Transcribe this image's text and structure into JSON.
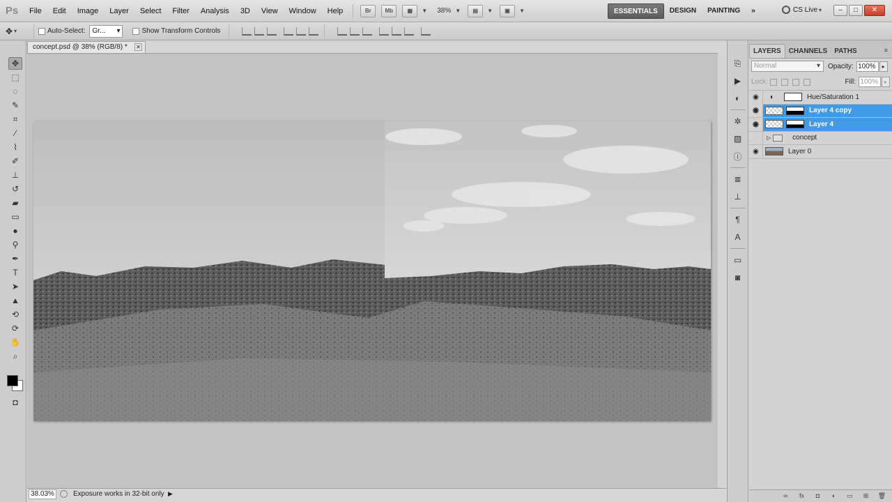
{
  "app": {
    "logo": "Ps"
  },
  "menu": [
    "File",
    "Edit",
    "Image",
    "Layer",
    "Select",
    "Filter",
    "Analysis",
    "3D",
    "View",
    "Window",
    "Help"
  ],
  "toolbar": {
    "bridge": "Br",
    "minibridge": "Mb",
    "zoom": "38%"
  },
  "workspaces": {
    "active": "ESSENTIALS",
    "design": "DESIGN",
    "painting": "PAINTING",
    "more": "»"
  },
  "cslive": "CS Live",
  "options": {
    "auto_select_label": "Auto-Select:",
    "auto_select_value": "Gr...",
    "transform_label": "Show Transform Controls"
  },
  "document": {
    "tab_title": "concept.psd @ 38% (RGB/8) *",
    "zoom": "38.03%",
    "status": "Exposure works in 32-bit only"
  },
  "layers_panel": {
    "tabs": [
      "LAYERS",
      "CHANNELS",
      "PATHS"
    ],
    "blend_mode": "Normal",
    "opacity_label": "Opacity:",
    "opacity": "100%",
    "lock_label": "Lock:",
    "fill_label": "Fill:",
    "fill": "100%",
    "layers": [
      {
        "name": "Hue/Saturation 1"
      },
      {
        "name": "Layer 4 copy"
      },
      {
        "name": "Layer 4"
      },
      {
        "name": "concept"
      },
      {
        "name": "Layer 0"
      }
    ]
  },
  "colors": {
    "selection": "#3f9ae8",
    "active_workspace": "#6a6a6a"
  }
}
